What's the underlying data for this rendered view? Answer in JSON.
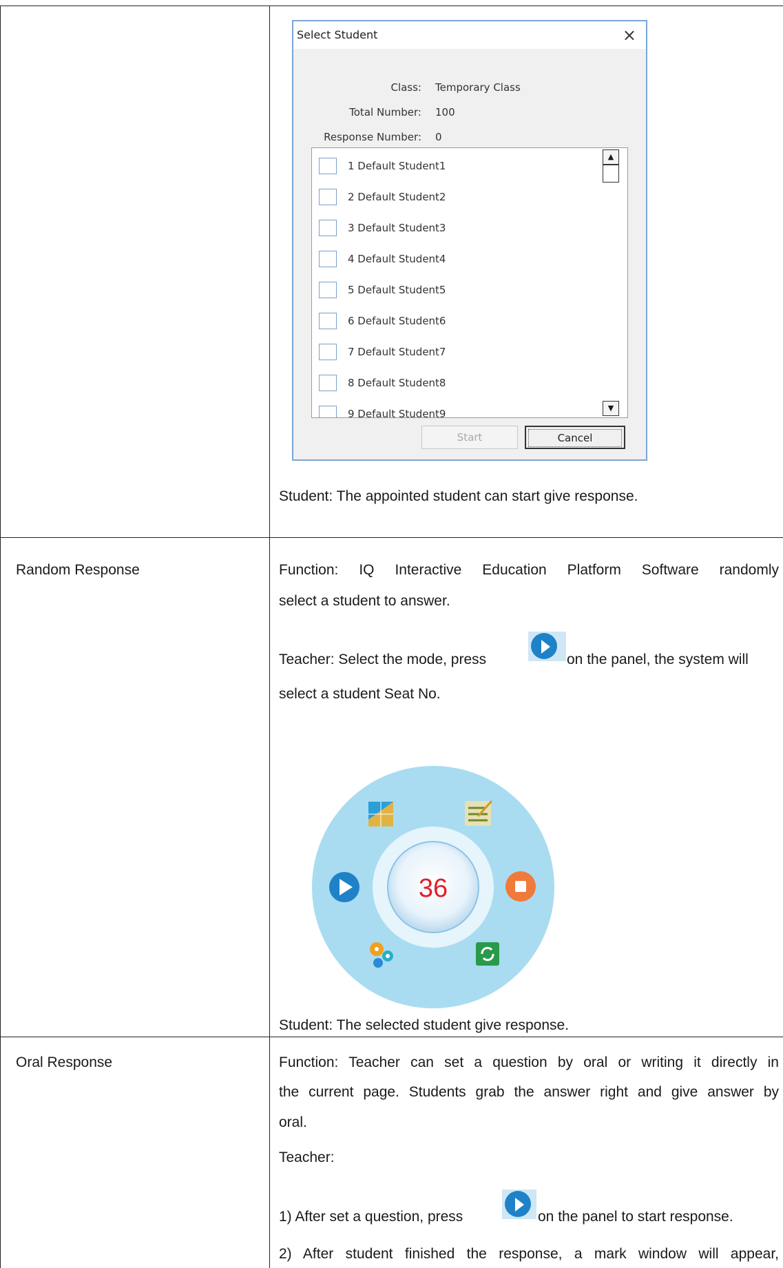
{
  "dialog": {
    "title": "Select Student",
    "close_symbol": "×",
    "class_label": "Class:",
    "class_value": "Temporary Class",
    "total_label": "Total Number:",
    "total_value": "100",
    "response_label": "Response Number:",
    "response_value": "0",
    "students": [
      "1 Default Student1",
      "2 Default Student2",
      "3 Default Student3",
      "4 Default Student4",
      "5 Default Student5",
      "6 Default Student6",
      "7 Default Student7",
      "8 Default Student8",
      "9 Default Student9"
    ],
    "start_label": "Start",
    "cancel_label": "Cancel"
  },
  "row1": {
    "student_text": "Student: The appointed student can start give response."
  },
  "row2": {
    "name": "Random Response",
    "function_line1": "Function:  IQ  Interactive  Education  Platform  Software  randomly",
    "function_line2": "select a student to answer.",
    "teacher_before": "Teacher: Select the mode, press",
    "teacher_after": "on the panel, the system will",
    "teacher_line2": "select a student Seat No.",
    "wheel_number": "36",
    "student_text": "Student: The selected student give response."
  },
  "row3": {
    "name": "Oral Response",
    "function_line1": "Function: Teacher can set a question by oral or writing it directly in",
    "function_line2": "the current page. Students grab the answer right and give answer by",
    "function_line3": "oral.",
    "teacher_label": "Teacher:",
    "step1_before": "1)  After set a question, press",
    "step1_after": "on the panel to start response.",
    "step2": "2)  After  student  finished  the  response,  a  mark  window  will  appear,"
  },
  "colors": {
    "wheel_outer": "#a9dcf0",
    "play_blue": "#1f82c8",
    "stop_orange": "#f07a3c",
    "number_red": "#e0202a",
    "dialog_border": "#7aa5d6"
  },
  "icons": [
    "play-icon",
    "stop-icon",
    "chart-icon",
    "edit-list-icon",
    "settings-gears-icon",
    "refresh-icon",
    "close-icon",
    "scroll-up-icon",
    "scroll-down-icon"
  ]
}
